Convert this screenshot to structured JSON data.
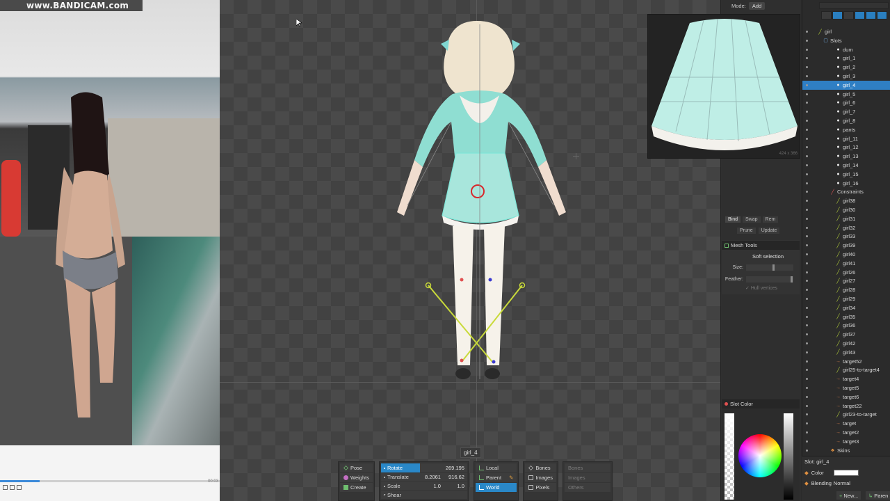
{
  "video": {
    "watermark": "www.BANDICAM.com",
    "progress_fraction": 0.18,
    "time_label": "00:03"
  },
  "viewport": {
    "selected_tag": "girl_4"
  },
  "toolbar": {
    "modes": [
      "Pose",
      "Weights",
      "Create"
    ],
    "transforms": [
      {
        "label": "Rotate",
        "v1": "",
        "v2": "269.195",
        "active": true
      },
      {
        "label": "Translate",
        "v1": "8.2061",
        "v2": "916.62",
        "active": false
      },
      {
        "label": "Scale",
        "v1": "1.0",
        "v2": "1.0",
        "active": false
      },
      {
        "label": "Shear",
        "v1": "",
        "v2": "",
        "active": false
      }
    ],
    "axes": [
      "Local",
      "Parent",
      "World"
    ],
    "compensate": [
      "Bones",
      "Images",
      "Pixels"
    ],
    "options": [
      "Bones",
      "Images",
      "Others"
    ]
  },
  "mode_bar": {
    "label": "Mode:",
    "value": "Add"
  },
  "preview": {
    "dimensions": "424 x 366"
  },
  "bind_tools": {
    "bind": "Bind",
    "swap": "Swap",
    "remove": "Rem",
    "prune": "Prune",
    "update": "Update"
  },
  "mesh_tools": {
    "title": "Mesh Tools",
    "soft_selection": "Soft selection",
    "size_label": "Size:",
    "feather_label": "Feather:",
    "hull_vertices": "Hull vertices"
  },
  "slot_color": {
    "title": "Slot Color"
  },
  "tree": {
    "rows": [
      {
        "label": "girl",
        "glyph": "bone",
        "indent": 22,
        "selected": false
      },
      {
        "label": "Slots",
        "glyph": "folder",
        "indent": 30,
        "selected": false
      },
      {
        "label": "dum",
        "glyph": "slot",
        "indent": 48,
        "selected": false
      },
      {
        "label": "girl_1",
        "glyph": "slot",
        "indent": 48,
        "selected": false
      },
      {
        "label": "girl_2",
        "glyph": "slot",
        "indent": 48,
        "selected": false
      },
      {
        "label": "girl_3",
        "glyph": "slot",
        "indent": 48,
        "selected": false
      },
      {
        "label": "girl_4",
        "glyph": "slot",
        "indent": 48,
        "selected": true
      },
      {
        "label": "girl_5",
        "glyph": "slot",
        "indent": 48,
        "selected": false
      },
      {
        "label": "girl_6",
        "glyph": "slot",
        "indent": 48,
        "selected": false
      },
      {
        "label": "girl_7",
        "glyph": "slot",
        "indent": 48,
        "selected": false
      },
      {
        "label": "girl_8",
        "glyph": "slot",
        "indent": 48,
        "selected": false
      },
      {
        "label": "pants",
        "glyph": "slot",
        "indent": 48,
        "selected": false
      },
      {
        "label": "girl_11",
        "glyph": "slot",
        "indent": 48,
        "selected": false
      },
      {
        "label": "girl_12",
        "glyph": "slot",
        "indent": 48,
        "selected": false
      },
      {
        "label": "girl_13",
        "glyph": "slot",
        "indent": 48,
        "selected": false
      },
      {
        "label": "girl_14",
        "glyph": "slot",
        "indent": 48,
        "selected": false
      },
      {
        "label": "girl_15",
        "glyph": "slot",
        "indent": 48,
        "selected": false
      },
      {
        "label": "girl_16",
        "glyph": "slot",
        "indent": 48,
        "selected": false
      },
      {
        "label": "Constraints",
        "glyph": "red",
        "indent": 40,
        "selected": false
      },
      {
        "label": "girl38",
        "glyph": "bone",
        "indent": 48,
        "selected": false
      },
      {
        "label": "girl30",
        "glyph": "bone",
        "indent": 48,
        "selected": false
      },
      {
        "label": "girl31",
        "glyph": "bone",
        "indent": 48,
        "selected": false
      },
      {
        "label": "girl32",
        "glyph": "bone",
        "indent": 48,
        "selected": false
      },
      {
        "label": "girl33",
        "glyph": "bone",
        "indent": 48,
        "selected": false
      },
      {
        "label": "girl39",
        "glyph": "bone",
        "indent": 48,
        "selected": false
      },
      {
        "label": "girl40",
        "glyph": "bone",
        "indent": 48,
        "selected": false
      },
      {
        "label": "girl41",
        "glyph": "bone",
        "indent": 48,
        "selected": false
      },
      {
        "label": "girl26",
        "glyph": "bone",
        "indent": 48,
        "selected": false
      },
      {
        "label": "girl27",
        "glyph": "bone",
        "indent": 48,
        "selected": false
      },
      {
        "label": "girl28",
        "glyph": "bone",
        "indent": 48,
        "selected": false
      },
      {
        "label": "girl29",
        "glyph": "bone",
        "indent": 48,
        "selected": false
      },
      {
        "label": "girl34",
        "glyph": "bone",
        "indent": 48,
        "selected": false
      },
      {
        "label": "girl35",
        "glyph": "bone",
        "indent": 48,
        "selected": false
      },
      {
        "label": "girl36",
        "glyph": "bone",
        "indent": 48,
        "selected": false
      },
      {
        "label": "girl37",
        "glyph": "bone",
        "indent": 48,
        "selected": false
      },
      {
        "label": "girl42",
        "glyph": "bone",
        "indent": 48,
        "selected": false
      },
      {
        "label": "girl43",
        "glyph": "bone",
        "indent": 48,
        "selected": false
      },
      {
        "label": "target52",
        "glyph": "target",
        "indent": 48,
        "selected": false
      },
      {
        "label": "girl25-to-target4",
        "glyph": "bone",
        "indent": 48,
        "selected": false
      },
      {
        "label": "target4",
        "glyph": "target",
        "indent": 48,
        "selected": false
      },
      {
        "label": "target5",
        "glyph": "target",
        "indent": 48,
        "selected": false
      },
      {
        "label": "target6",
        "glyph": "target",
        "indent": 48,
        "selected": false
      },
      {
        "label": "target22",
        "glyph": "target",
        "indent": 48,
        "selected": false
      },
      {
        "label": "girl23-to-target",
        "glyph": "bone",
        "indent": 48,
        "selected": false
      },
      {
        "label": "target",
        "glyph": "target",
        "indent": 48,
        "selected": false
      },
      {
        "label": "target2",
        "glyph": "target",
        "indent": 48,
        "selected": false
      },
      {
        "label": "target3",
        "glyph": "target",
        "indent": 48,
        "selected": false
      },
      {
        "label": "Skins",
        "glyph": "skin",
        "indent": 40,
        "selected": false
      }
    ]
  },
  "tree_footer": {
    "title": "Slot: girl_4",
    "color_label": "Color",
    "blending_label": "Blending",
    "blending_value": "Normal",
    "new_button": "New...",
    "parent_button": "Paren"
  },
  "colors": {
    "accent": "#2a88c8",
    "selection": "#2f7fc4",
    "bone": "#b7d43a",
    "mesh": "#7fe6d8"
  }
}
